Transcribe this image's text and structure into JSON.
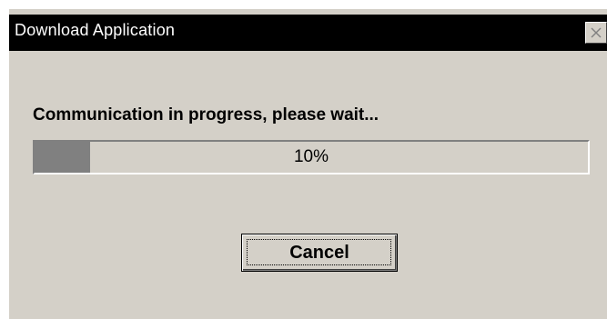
{
  "window": {
    "title": "Download Application",
    "close_icon": "close-icon"
  },
  "dialog": {
    "message": "Communication in progress, please wait...",
    "progress": {
      "value_percent": 10,
      "label": "10%",
      "fill_color": "#808080"
    },
    "cancel_label": "Cancel"
  },
  "colors": {
    "titlebar": "#000000",
    "face": "#d4d0c8"
  }
}
